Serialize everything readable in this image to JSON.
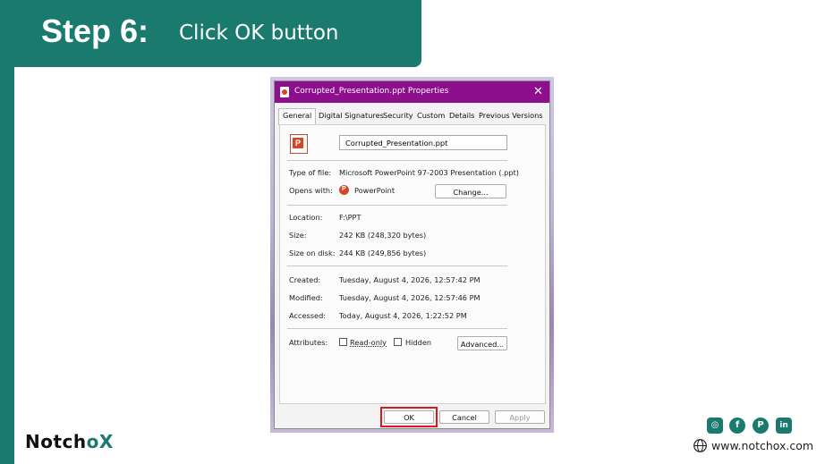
{
  "step": {
    "title": "Step 6:",
    "subtitle": "Click OK button"
  },
  "dialog": {
    "title": "Corrupted_Presentation.ppt Properties",
    "close_icon": "close-icon",
    "tabs": [
      {
        "label": "General",
        "active": true
      },
      {
        "label": "Digital Signatures"
      },
      {
        "label": "Security"
      },
      {
        "label": "Custom"
      },
      {
        "label": "Details"
      },
      {
        "label": "Previous Versions"
      }
    ],
    "filename": "Corrupted_Presentation.ppt",
    "fields": {
      "type_label": "Type of file:",
      "type_value": "Microsoft PowerPoint 97-2003 Presentation (.ppt)",
      "opens_label": "Opens with:",
      "opens_value": "PowerPoint",
      "change_button": "Change...",
      "location_label": "Location:",
      "location_value": "F:\\PPT",
      "size_label": "Size:",
      "size_value": "242 KB (248,320 bytes)",
      "sizedisk_label": "Size on disk:",
      "sizedisk_value": "244 KB (249,856 bytes)",
      "created_label": "Created:",
      "created_value": "Tuesday, August 4, 2026, 12:57:42 PM",
      "modified_label": "Modified:",
      "modified_value": "Tuesday, August 4, 2026, 12:57:46 PM",
      "accessed_label": "Accessed:",
      "accessed_value": "Today, August 4, 2026, 1:22:52 PM",
      "attributes_label": "Attributes:",
      "readonly_label": "Read-only",
      "hidden_label": "Hidden",
      "advanced_button": "Advanced..."
    },
    "buttons": {
      "ok": "OK",
      "cancel": "Cancel",
      "apply": "Apply"
    },
    "highlight_color": "#d21b23"
  },
  "footer": {
    "brand_pre": "Notch",
    "brand_o": "o",
    "brand_x": "X",
    "social": [
      "instagram-icon",
      "facebook-icon",
      "pinterest-icon",
      "linkedin-icon"
    ],
    "website": "www.notchox.com"
  },
  "colors": {
    "brand_teal": "#1a7a6e",
    "titlebar_purple": "#8e0f8e"
  }
}
